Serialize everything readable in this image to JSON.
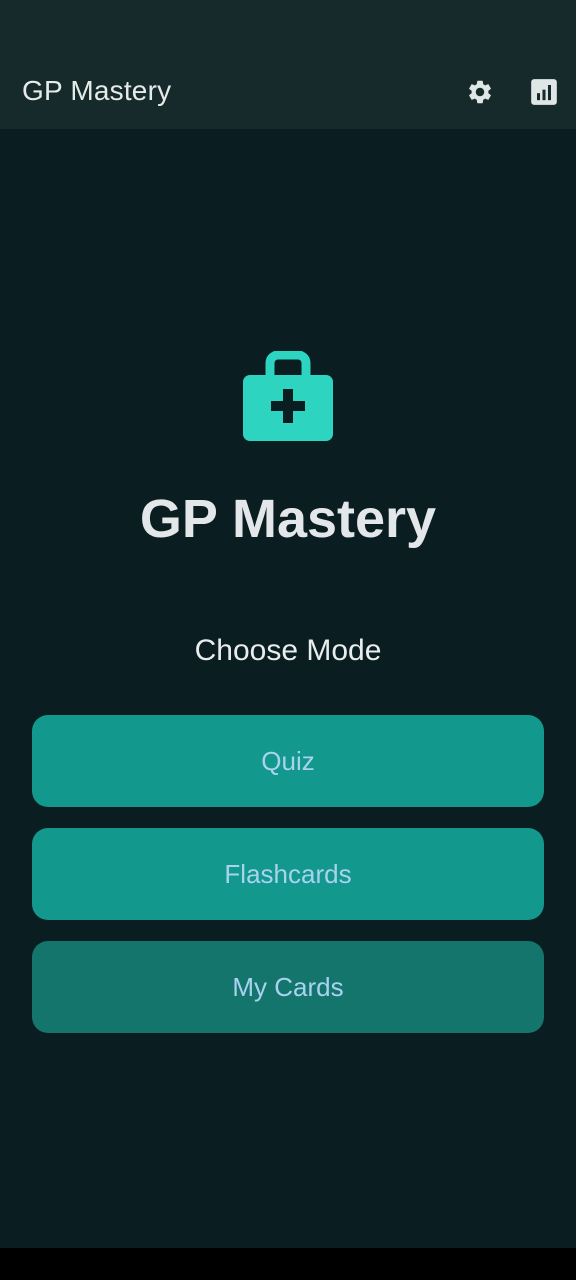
{
  "app_bar": {
    "title": "GP Mastery",
    "actions": [
      {
        "icon": "gear-icon"
      },
      {
        "icon": "bar-chart-icon"
      }
    ]
  },
  "hero": {
    "icon": "medical-bag-icon",
    "title": "GP Mastery"
  },
  "mode_section": {
    "heading": "Choose Mode",
    "buttons": [
      {
        "label": "Quiz"
      },
      {
        "label": "Flashcards"
      },
      {
        "label": "My Cards"
      }
    ]
  },
  "colors": {
    "background": "#0a1e22",
    "app_bar": "#172a2b",
    "accent": "#2dd4bf",
    "primary_button": "#12988d",
    "secondary_button": "#14756d",
    "button_text": "#a9d2ef"
  }
}
